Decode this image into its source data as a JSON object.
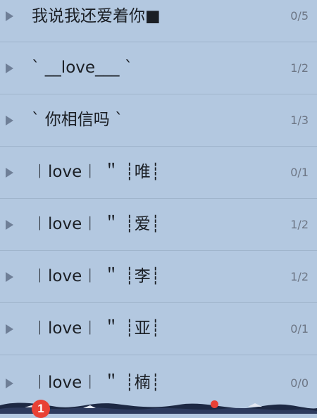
{
  "groups": [
    {
      "name": "我说我还爱着你■",
      "count": "0/5"
    },
    {
      "name": "ˋ __love___ ˋ",
      "count": "1/2"
    },
    {
      "name": "ˋ 你相信吗 ˋ",
      "count": "1/3"
    },
    {
      "name": "︱love︱ ＂ ┊唯┊",
      "count": "0/1"
    },
    {
      "name": "︱love︱ ＂ ┊爱┊",
      "count": "1/2"
    },
    {
      "name": "︱love︱ ＂ ┊李┊",
      "count": "1/2"
    },
    {
      "name": "︱love︱ ＂ ┊亚┊",
      "count": "0/1"
    },
    {
      "name": "︱love︱ ＂ ┊楠┊",
      "count": "0/0"
    }
  ],
  "notification_badge": "1",
  "icons": {
    "row_arrow": "triangle-right-icon",
    "bottom_art": "wave-scenery"
  }
}
